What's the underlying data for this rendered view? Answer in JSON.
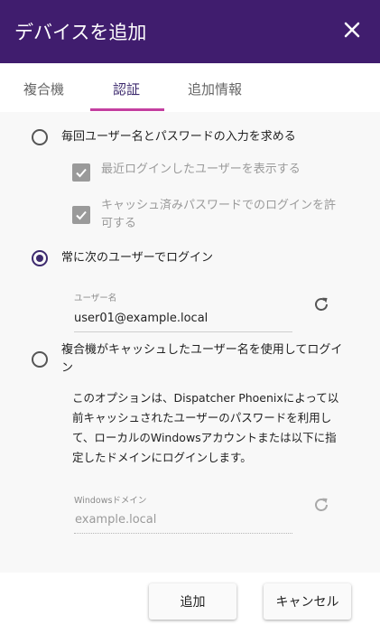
{
  "dialog": {
    "title": "デバイスを追加",
    "close_icon": "close-icon"
  },
  "tabs": [
    {
      "label": "複合機",
      "active": false
    },
    {
      "label": "認証",
      "active": true
    },
    {
      "label": "追加情報",
      "active": false
    }
  ],
  "options": {
    "prompt_each_time": {
      "label": "毎回ユーザー名とパスワードの入力を求める",
      "selected": false
    },
    "show_last_login": {
      "label": "最近ログインしたユーザーを表示する",
      "checked": true,
      "disabled": true
    },
    "allow_cached_password": {
      "label": "キャッシュ済みパスワードでのログインを許可する",
      "checked": true,
      "disabled": true
    },
    "always_login_as": {
      "label": "常に次のユーザーでログイン",
      "selected": true
    },
    "username_field": {
      "label": "ユーザー名",
      "value": "user01@example.local"
    },
    "use_cached_username": {
      "label": "複合機がキャッシュしたユーザー名を使用してログイン",
      "selected": false
    },
    "cached_description": "このオプションは、Dispatcher Phoenixによって以前キャッシュされたユーザーのパスワードを利用して、ローカルのWindowsアカウントまたは以下に指定したドメインにログインします。",
    "windows_domain_field": {
      "label": "Windowsドメイン",
      "value": "example.local",
      "disabled": true
    }
  },
  "footer": {
    "add_label": "追加",
    "cancel_label": "キャンセル"
  },
  "colors": {
    "header_bg": "#401d6e",
    "accent": "#3d2a6e",
    "tab_underline": "#c43fa0"
  }
}
